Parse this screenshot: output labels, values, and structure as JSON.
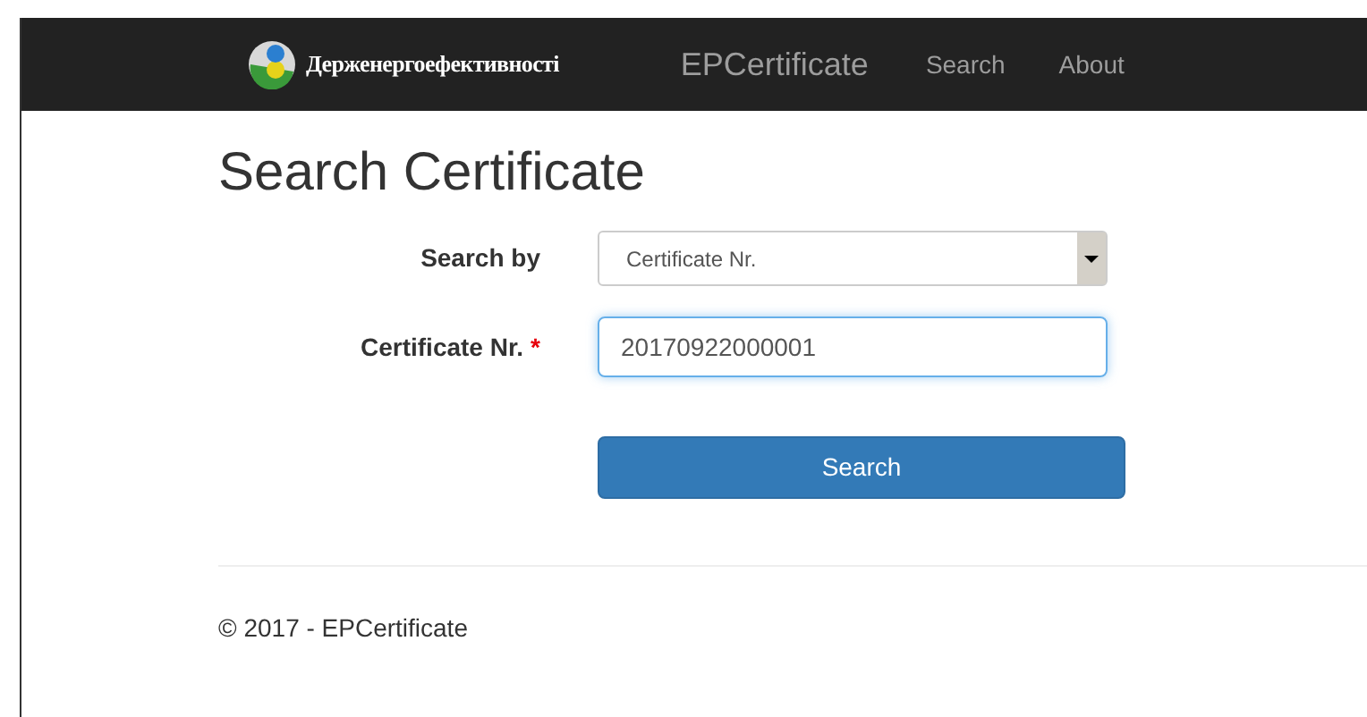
{
  "navbar": {
    "brand_text": "Держенергоефективності",
    "app_name": "EPCertificate",
    "links": [
      "Search",
      "About"
    ]
  },
  "title": "Search Certificate",
  "form": {
    "search_by": {
      "label": "Search by",
      "value": "Certificate Nr."
    },
    "certificate_nr": {
      "label": "Certificate Nr.",
      "required_mark": "*",
      "value": "20170922000001"
    },
    "button": "Search"
  },
  "footer": "© 2017 - EPCertificate"
}
